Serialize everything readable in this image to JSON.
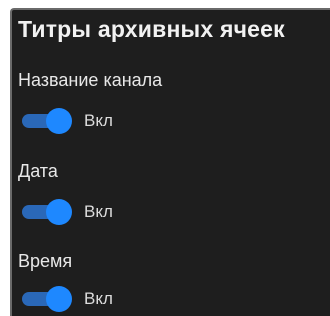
{
  "panel": {
    "title": "Титры архивных ячеек"
  },
  "settings": [
    {
      "label": "Название канала",
      "toggle_text": "Вкл",
      "enabled": true
    },
    {
      "label": "Дата",
      "toggle_text": "Вкл",
      "enabled": true
    },
    {
      "label": "Время",
      "toggle_text": "Вкл",
      "enabled": true
    }
  ],
  "colors": {
    "panel_bg": "#1e1e1e",
    "toggle_track": "#2a68b8",
    "toggle_knob": "#1e88ff",
    "text": "#e8e8e8"
  }
}
